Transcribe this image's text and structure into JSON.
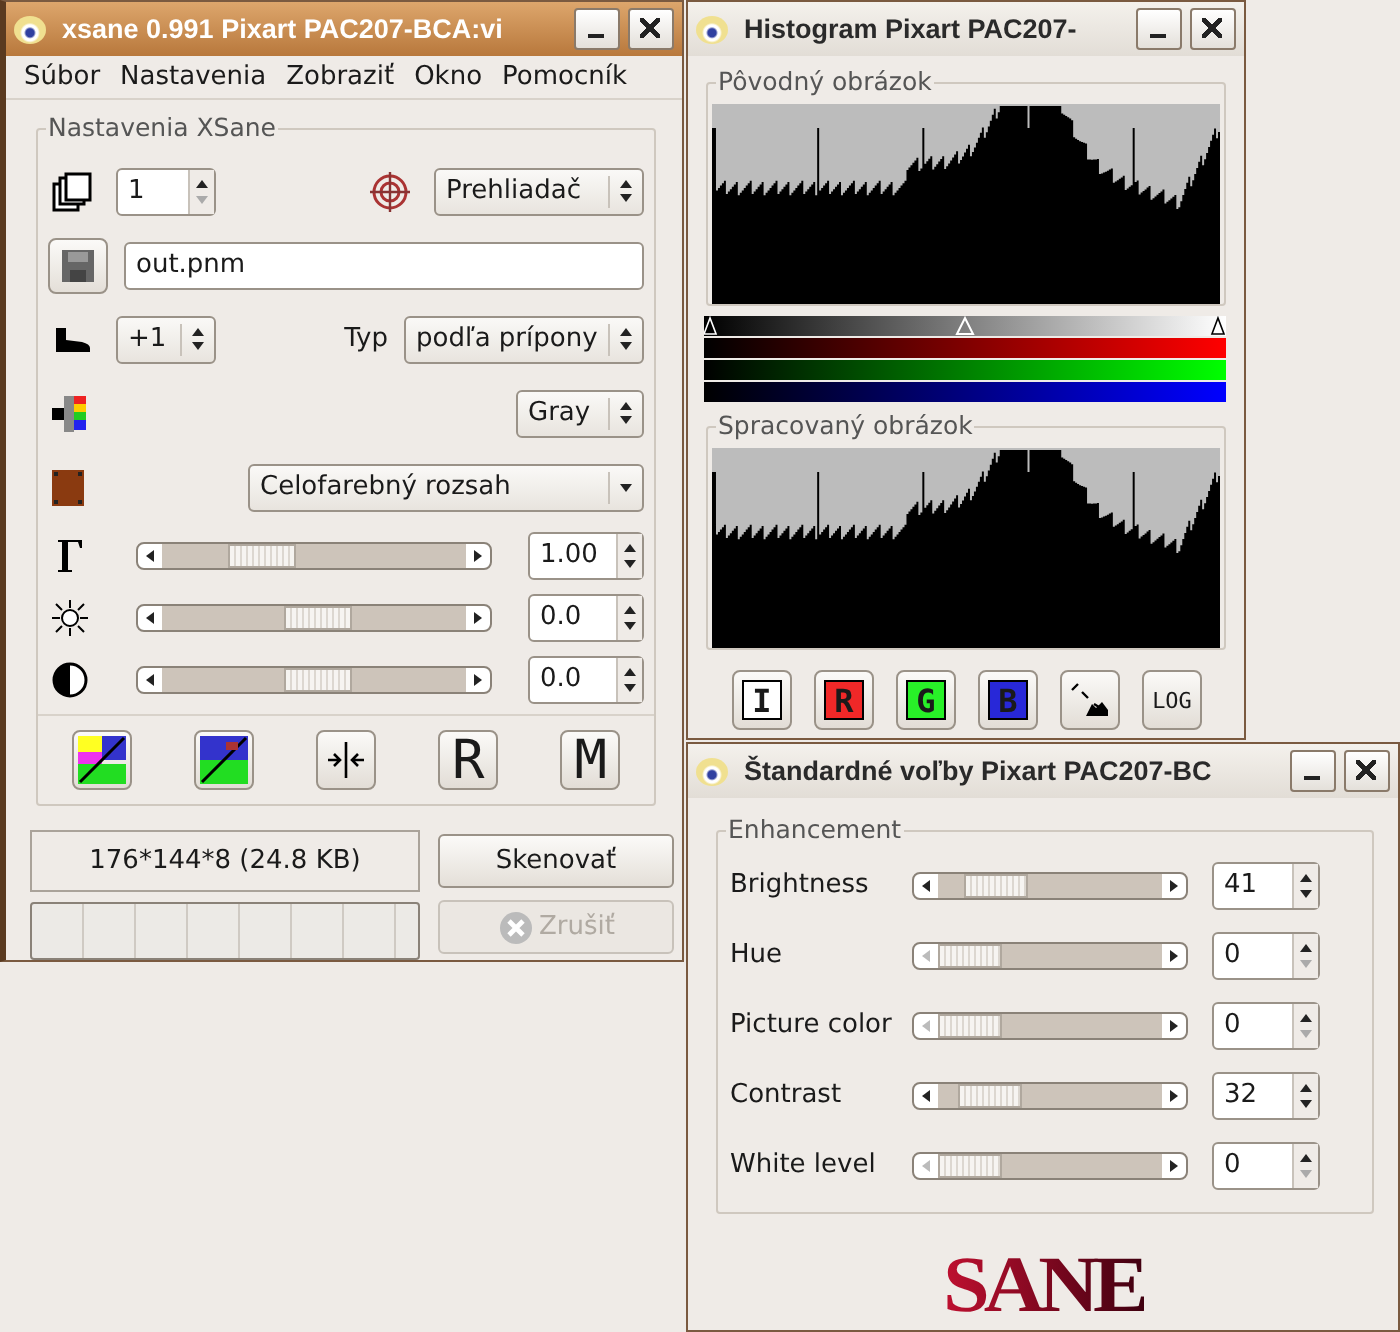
{
  "xsane_window": {
    "title": "xsane 0.991 Pixart PAC207-BCA:vi",
    "menu": [
      "Súbor",
      "Nastavenia",
      "Zobraziť",
      "Okno",
      "Pomocník"
    ],
    "frame_title": "Nastavenia XSane",
    "copies": {
      "value": "1"
    },
    "source": {
      "value": "Prehliadač"
    },
    "filename": {
      "value": "out.pnm"
    },
    "step": {
      "value": "+1"
    },
    "type": {
      "label": "Typ",
      "value": "podľa prípony"
    },
    "color_mode": {
      "value": "Gray"
    },
    "range": {
      "value": "Celofarebný rozsah"
    },
    "sliders": [
      {
        "kind": "gamma",
        "level": 0.28,
        "value": "1.00"
      },
      {
        "kind": "brightness",
        "level": 0.52,
        "value": "0.0"
      },
      {
        "kind": "contrast",
        "level": 0.52,
        "value": "0.0"
      }
    ],
    "tool_buttons": [
      {
        "kind": "auto-enhance"
      },
      {
        "kind": "default-enhance"
      },
      {
        "kind": "symmetry"
      },
      {
        "kind": "letter",
        "label": "R"
      },
      {
        "kind": "letter",
        "label": "M"
      }
    ],
    "image_info": "176*144*8 (24.8 KB)",
    "scan_button": {
      "label": "Skenovať",
      "disabled": false
    },
    "cancel_button": {
      "label": "Zrušiť",
      "disabled": true
    },
    "progress": {
      "level": 0
    }
  },
  "histogram_window": {
    "title": "Histogram Pixart PAC207-",
    "original_title": "Pôvodný obrázok",
    "processed_title": "Spracovaný obrázok",
    "buttons": [
      {
        "kind": "letter",
        "label": "I",
        "color": "#ffffff"
      },
      {
        "kind": "letter",
        "label": "R",
        "color": "#f02828"
      },
      {
        "kind": "letter",
        "label": "G",
        "color": "#28f028"
      },
      {
        "kind": "letter",
        "label": "B",
        "color": "#2828d8"
      },
      {
        "kind": "lines"
      },
      {
        "kind": "plain",
        "label": "LOG"
      }
    ]
  },
  "options_window": {
    "title": "Štandardné voľby Pixart PAC207-BC",
    "frame_title": "Enhancement",
    "rows": [
      {
        "label": "Brightness",
        "level": 0.16,
        "value": "41"
      },
      {
        "label": "Hue",
        "level": 0,
        "value": "0"
      },
      {
        "label": "Picture color",
        "level": 0,
        "value": "0"
      },
      {
        "label": "Contrast",
        "level": 0.12,
        "value": "32"
      },
      {
        "label": "White level",
        "level": 0,
        "value": "0"
      }
    ],
    "logo": "SANE"
  }
}
